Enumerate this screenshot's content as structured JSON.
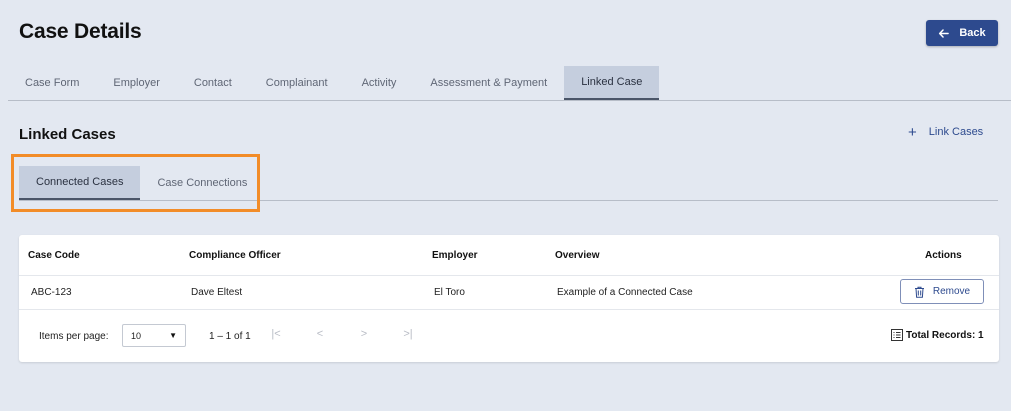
{
  "page": {
    "title": "Case Details",
    "back_label": "Back"
  },
  "main_tabs": [
    {
      "label": "Case Form",
      "active": false
    },
    {
      "label": "Employer",
      "active": false
    },
    {
      "label": "Contact",
      "active": false
    },
    {
      "label": "Complainant",
      "active": false
    },
    {
      "label": "Activity",
      "active": false
    },
    {
      "label": "Assessment & Payment",
      "active": false
    },
    {
      "label": "Linked Case",
      "active": true
    }
  ],
  "section": {
    "title": "Linked Cases",
    "link_cases_label": "Link Cases"
  },
  "sub_tabs": [
    {
      "label": "Connected Cases",
      "active": true
    },
    {
      "label": "Case Connections",
      "active": false
    }
  ],
  "table": {
    "headers": {
      "case_code": "Case Code",
      "compliance_officer": "Compliance Officer",
      "employer": "Employer",
      "overview": "Overview",
      "actions": "Actions"
    },
    "rows": [
      {
        "case_code": "ABC-123",
        "compliance_officer": "Dave Eltest",
        "employer": "El Toro",
        "overview": "Example of a Connected Case",
        "action_label": "Remove"
      }
    ]
  },
  "pagination": {
    "items_per_page_label": "Items per page:",
    "page_size": "10",
    "range": "1 – 1 of 1",
    "total_records": "Total Records: 1"
  },
  "icons": {
    "back": "arrow-left-icon",
    "link": "plus-icon",
    "remove": "trash-icon",
    "total": "list-icon"
  },
  "colors": {
    "primary": "#2d4a8e",
    "background": "#e3e8f1",
    "active_tab": "#c5cede",
    "highlight": "#f28c28"
  }
}
